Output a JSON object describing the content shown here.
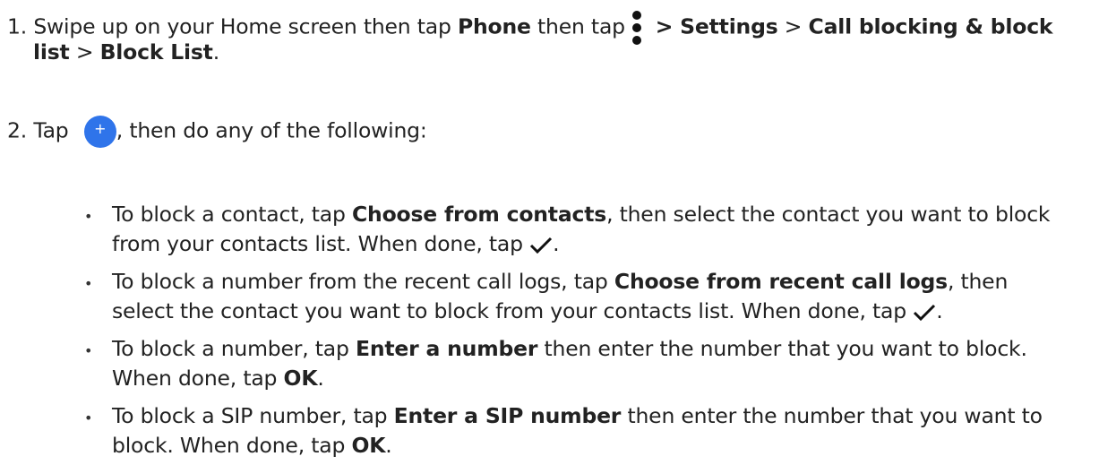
{
  "step1": {
    "num": "1.",
    "pre": "Swipe up on your Home screen then tap ",
    "phone": "Phone",
    "then_tap": " then tap ",
    "settings": "> Settings",
    "sep1": " > ",
    "call_blocking": "Call blocking & block",
    "list": "list",
    "sep2": " > ",
    "block_list": "Block List",
    "period": "."
  },
  "step2": {
    "num": "2.",
    "tap": "Tap",
    "rest": ", then do any of the following:",
    "fab_symbol": "+"
  },
  "bullets": [
    {
      "pre": "To block a contact, tap ",
      "bold": "Choose from contacts",
      "post": ", then select the contact you want to block",
      "line2": "from your contacts list. When done, tap ",
      "end": "."
    },
    {
      "pre": "To block a number from the recent call logs, tap ",
      "bold": "Choose from recent call logs",
      "post": ", then",
      "line2": "select the contact you want to block from your contacts list. When done, tap ",
      "end": "."
    },
    {
      "pre": "To block a number, tap ",
      "bold": "Enter a number",
      "post": " then enter the number that you want to block.",
      "line2": "When done, tap ",
      "ok": "OK",
      "end": "."
    },
    {
      "pre": "To block a SIP number, tap ",
      "bold": "Enter a SIP number",
      "post": " then enter the number that you want to",
      "line2": "block. When done, tap ",
      "ok": "OK",
      "end": "."
    }
  ],
  "bullet_char": "•",
  "icons": {
    "menu": "more-vert-icon",
    "add": "add-fab-icon",
    "check": "check-icon"
  },
  "colors": {
    "fab": "#2f74ea",
    "text": "#222222"
  }
}
